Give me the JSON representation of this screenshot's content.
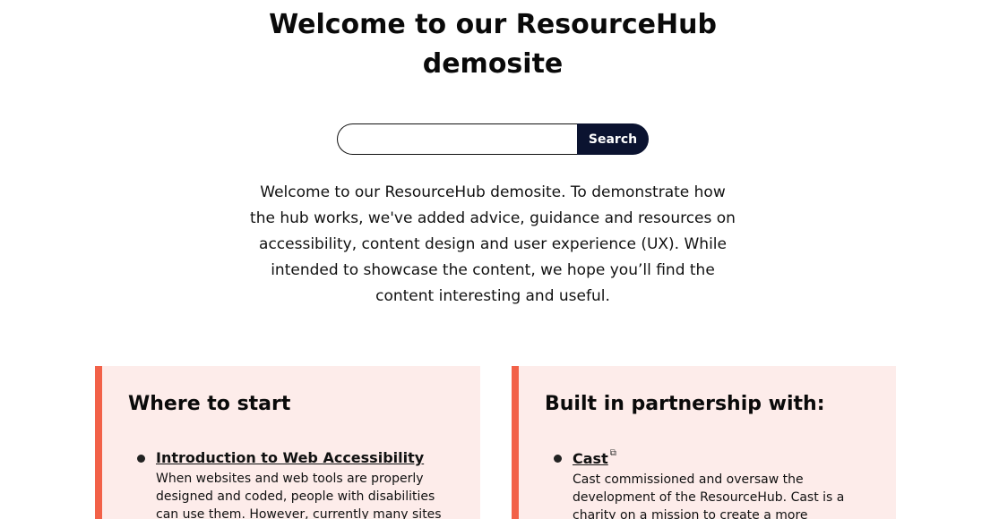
{
  "header": {
    "title": "Welcome to our ResourceHub demosite"
  },
  "search": {
    "placeholder": "",
    "value": "",
    "button_label": "Search"
  },
  "intro": {
    "text": "Welcome to our ResourceHub demosite. To demonstrate how the hub works, we've added advice, guidance and resources on accessibility, content design and user experience (UX). While intended to showcase the content, we hope you’ll find the content interesting and useful."
  },
  "cards": [
    {
      "title": "Where to start",
      "items": [
        {
          "link": "Introduction to Web Accessibility",
          "description": "When websites and web tools are properly designed and coded, people with disabilities can use them. However, currently many sites and"
        }
      ]
    },
    {
      "title": "Built in partnership with:",
      "items": [
        {
          "link": "Cast",
          "icon": "external-link-icon",
          "description": "Cast commissioned and oversaw the development of the ResourceHub. Cast is a charity on a mission to create a more responsive"
        }
      ]
    }
  ],
  "colors": {
    "accent": "#f26148",
    "card_background": "#fdecea",
    "button_background": "#0b1330"
  }
}
